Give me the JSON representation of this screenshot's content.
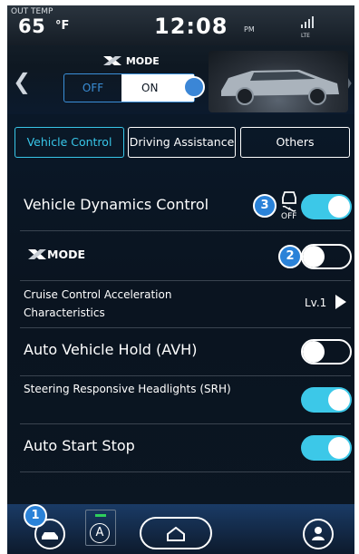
{
  "status": {
    "out_temp_label": "OUT TEMP",
    "out_temp_value": "65",
    "out_temp_unit": "°F",
    "clock": "12:08",
    "ampm": "PM",
    "network": "LTE"
  },
  "xmode_panel": {
    "title": "MODE",
    "off_label": "OFF",
    "on_label": "ON",
    "selected": "ON"
  },
  "tabs": [
    {
      "label": "Vehicle Control",
      "active": true
    },
    {
      "label": "Driving Assistance",
      "active": false
    },
    {
      "label": "Others",
      "active": false
    }
  ],
  "settings": [
    {
      "label": "Vehicle Dynamics Control",
      "state": "on",
      "callout": "3",
      "icon": "vdc-off-icon",
      "icon_text": "OFF"
    },
    {
      "label": "MODE",
      "state": "off",
      "callout": "2"
    },
    {
      "label": "Cruise Control Acceleration Characteristics",
      "value": "Lv.1"
    },
    {
      "label": "Auto Vehicle Hold (AVH)",
      "state": "off"
    },
    {
      "label": "Steering Responsive Headlights (SRH)",
      "state": "on"
    },
    {
      "label": "Auto Start Stop",
      "state": "on"
    }
  ],
  "bottom_nav": {
    "callout": "1",
    "items": [
      "car-icon",
      "drive-assist-icon",
      "home-icon",
      "profile-icon"
    ],
    "assist_letter": "A"
  },
  "colors": {
    "accent": "#3cc8e8",
    "callout": "#2a82d8",
    "panel_bg": "#0a1420"
  }
}
